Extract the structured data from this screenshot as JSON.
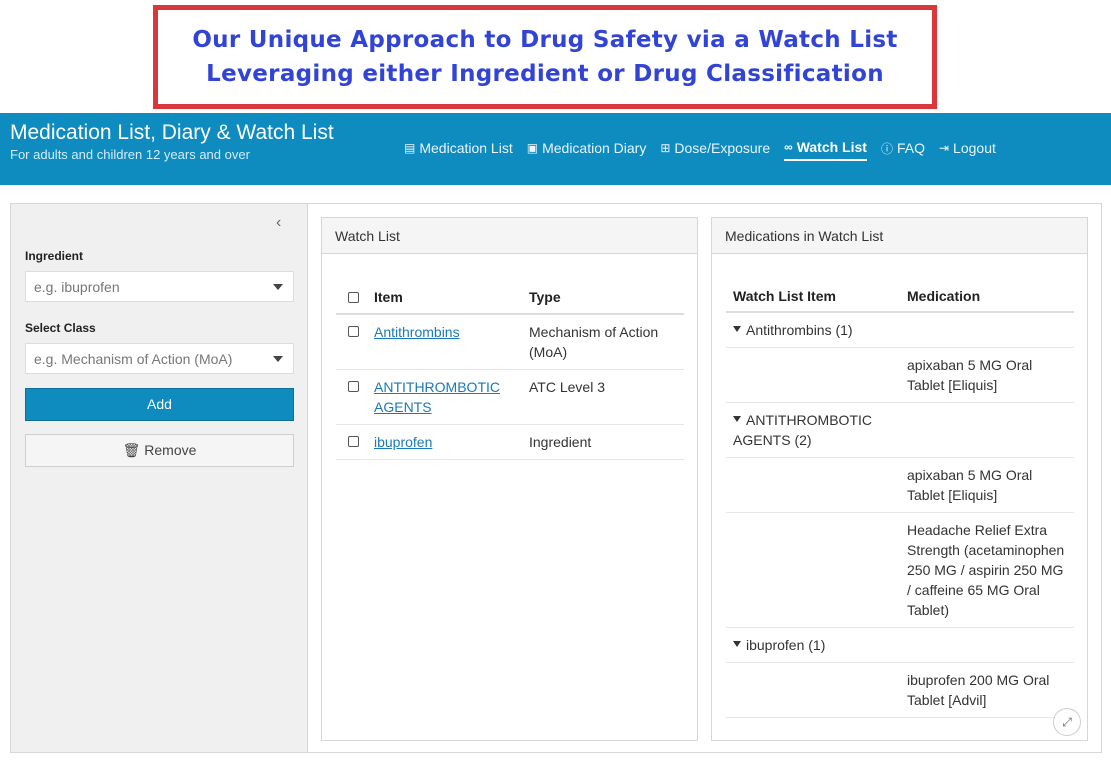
{
  "banner": {
    "line1": "Our Unique Approach to Drug Safety via a Watch List",
    "line2": "Leveraging either Ingredient or Drug Classification"
  },
  "header": {
    "title": "Medication List, Diary & Watch List",
    "subtitle": "For adults and children 12 years and over",
    "nav": [
      {
        "label": "Medication List",
        "icon": "list-icon"
      },
      {
        "label": "Medication Diary",
        "icon": "diary-icon"
      },
      {
        "label": "Dose/Exposure",
        "icon": "dose-icon"
      },
      {
        "label": "Watch List",
        "icon": "glasses-icon",
        "active": true
      },
      {
        "label": "FAQ",
        "icon": "question-icon"
      },
      {
        "label": "Logout",
        "icon": "logout-icon"
      }
    ]
  },
  "sidebar": {
    "collapse_icon": "‹",
    "ingredient_label": "Ingredient",
    "ingredient_placeholder": "e.g. ibuprofen",
    "class_label": "Select Class",
    "class_placeholder": "e.g. Mechanism of Action (MoA)",
    "add_label": "Add",
    "remove_label": "Remove"
  },
  "watch_list": {
    "heading": "Watch List",
    "columns": [
      "Item",
      "Type"
    ],
    "rows": [
      {
        "item": "Antithrombins",
        "type": "Mechanism of Action (MoA)"
      },
      {
        "item": "ANTITHROMBOTIC AGENTS",
        "type": "ATC Level 3"
      },
      {
        "item": "ibuprofen",
        "type": "Ingredient"
      }
    ]
  },
  "meds": {
    "heading": "Medications in Watch List",
    "columns": [
      "Watch List Item",
      "Medication"
    ],
    "groups": [
      {
        "label": "Antithrombins (1)",
        "items": [
          "apixaban 5 MG Oral Tablet [Eliquis]"
        ]
      },
      {
        "label": "ANTITHROMBOTIC AGENTS (2)",
        "items": [
          "apixaban 5 MG Oral Tablet [Eliquis]",
          "Headache Relief Extra Strength (acetaminophen 250 MG / aspirin 250 MG / caffeine 65 MG Oral Tablet)"
        ]
      },
      {
        "label": "ibuprofen (1)",
        "items": [
          "ibuprofen 200 MG Oral Tablet [Advil]"
        ]
      }
    ]
  }
}
